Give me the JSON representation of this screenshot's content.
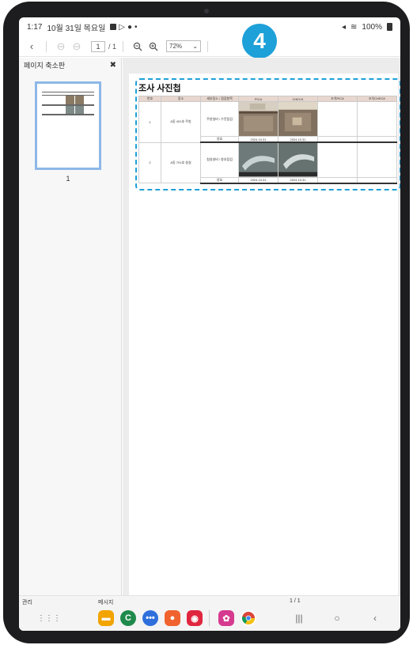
{
  "status": {
    "time": "1:17",
    "date": "10월 31일 목요일",
    "battery": "100%"
  },
  "toolbar": {
    "page_current": "1",
    "page_total": "/ 1",
    "zoom": "72%"
  },
  "annotation": {
    "step": "4"
  },
  "sidebar": {
    "title": "페이지 축소판",
    "thumb_number": "1"
  },
  "document": {
    "title": "조사 사진첩",
    "headers": [
      "번호",
      "장소",
      "세부장소 / 점검항목",
      "PICA",
      "CHECK",
      "조치PICA",
      "조치CHECK"
    ],
    "rows": [
      {
        "no": "1",
        "place": "A동 401호 주방",
        "detail": "주방설비 / 수전점검",
        "result": "양호",
        "date1": "2024.10.31",
        "date2": "2024.10.31"
      },
      {
        "no": "2",
        "place": "A동 701호 침실",
        "detail": "침실설비 / 창호점검",
        "result": "양호",
        "date1": "2024.10.31",
        "date2": "2024.10.31"
      }
    ]
  },
  "bottom": {
    "label_left": "관리",
    "label_mid": "메시지",
    "page_indicator": "1 / 1"
  },
  "colors": {
    "accent": "#1ea0d8",
    "device": "#1d1d1f",
    "header_row": "#e8d7cf"
  }
}
